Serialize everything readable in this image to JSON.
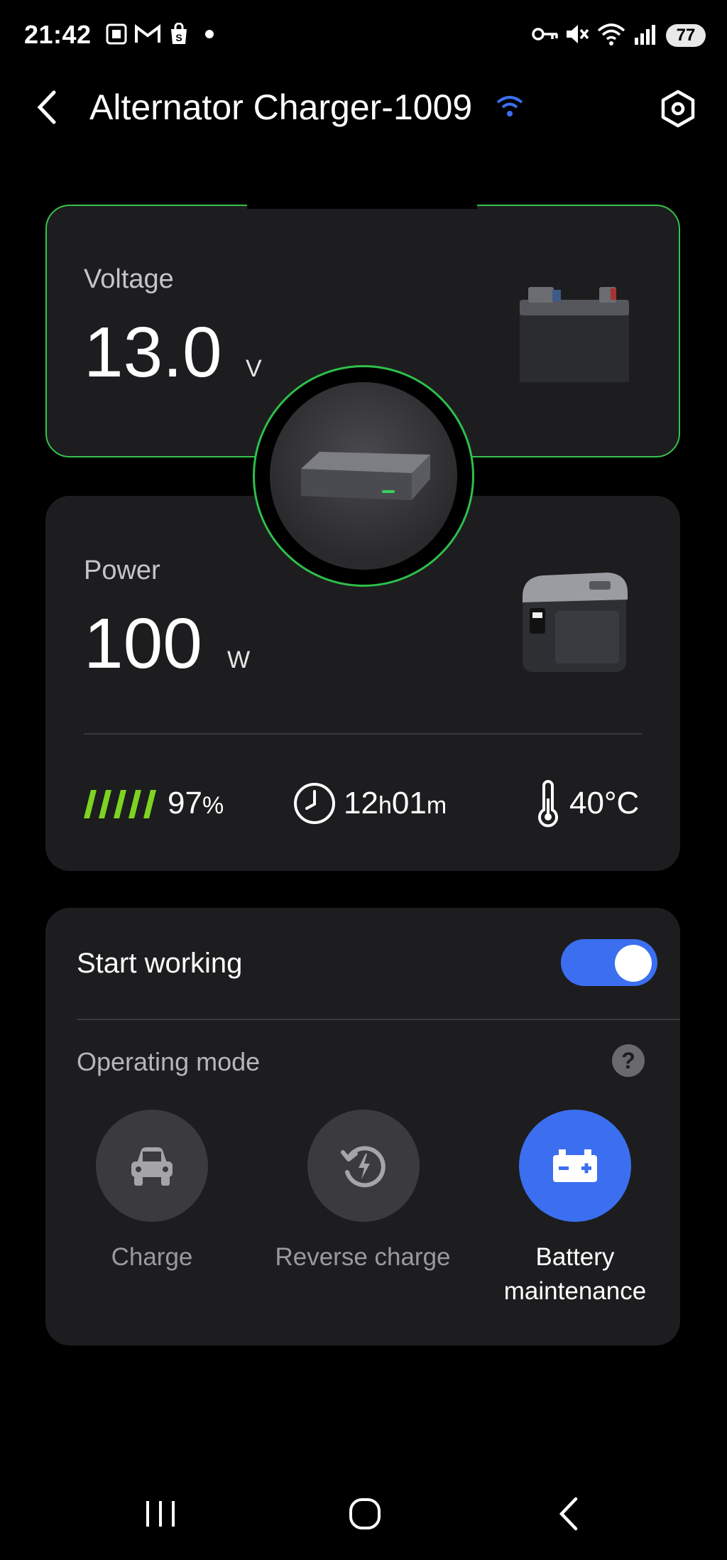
{
  "status_bar": {
    "time": "21:42",
    "battery": "77",
    "icons": [
      "screenshot-icon",
      "gmail-icon",
      "shop-icon",
      "dot-icon",
      "key-icon",
      "mute-icon",
      "wifi-icon",
      "signal-icon"
    ]
  },
  "header": {
    "title": "Alternator Charger-1009",
    "wifi_color": "#3b6ff0"
  },
  "voltage": {
    "label": "Voltage",
    "value": "13.0",
    "unit": "V"
  },
  "power": {
    "label": "Power",
    "value": "100",
    "unit": "W"
  },
  "stats": {
    "battery_percent": "97",
    "battery_percent_unit": "%",
    "time_hours": "12",
    "time_hours_unit": "h",
    "time_minutes": "01",
    "time_minutes_unit": "m",
    "temperature": "40°C"
  },
  "control": {
    "start_working_label": "Start working",
    "start_working_on": true,
    "operating_mode_label": "Operating mode",
    "help_symbol": "?",
    "modes": [
      {
        "label": "Charge",
        "icon": "car-icon",
        "active": false
      },
      {
        "label": "Reverse charge",
        "icon": "reverse-charge-icon",
        "active": false
      },
      {
        "label": "Battery\nmaintenance",
        "icon": "battery-icon",
        "active": true
      }
    ]
  },
  "colors": {
    "accent_green": "#36c24d",
    "accent_blue": "#3b6ff0",
    "bar_green": "#7ed321"
  }
}
